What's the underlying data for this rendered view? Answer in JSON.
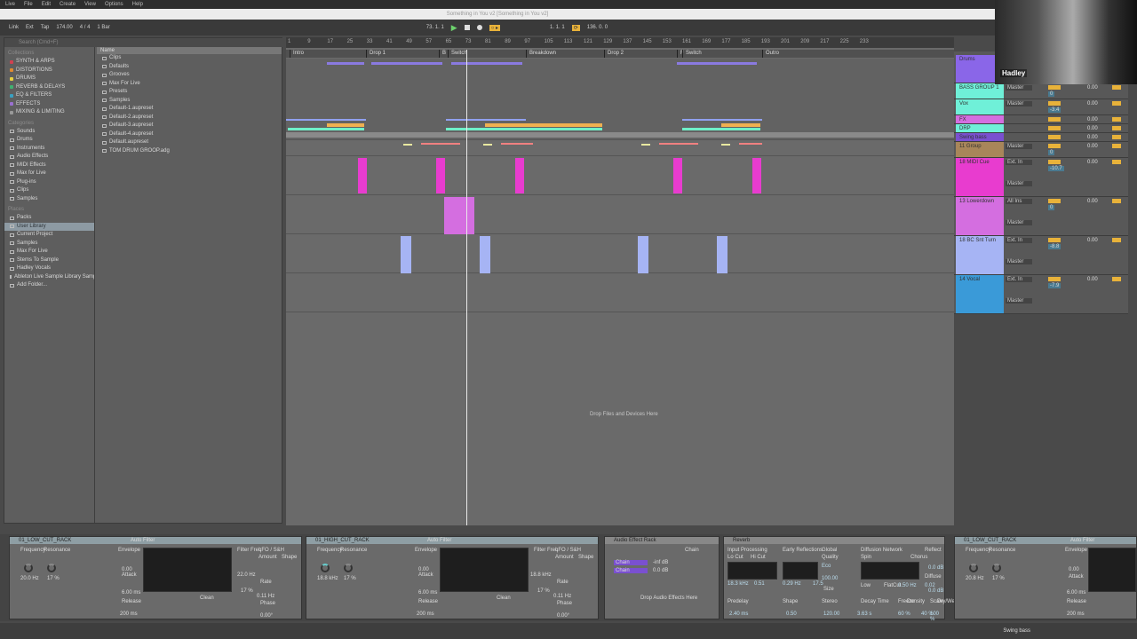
{
  "menubar": {
    "items": [
      "Live",
      "File",
      "Edit",
      "Create",
      "View",
      "Options",
      "Help"
    ]
  },
  "window": {
    "title": "Something in You v2  [Something in You v2]"
  },
  "transport": {
    "link": "Link",
    "ext": "Ext",
    "tap": "Tap",
    "tempo": "174.00",
    "time_signature": "4 / 4",
    "quantize": "1 Bar",
    "arrangement_position": "73. 1. 1",
    "loop_start": "1. 1. 1",
    "loop_length": "136. 0. 0"
  },
  "browser": {
    "search_placeholder": "Search (Cmd+F)",
    "collections_title": "Collections",
    "collections": [
      {
        "label": "SYNTH & ARPS",
        "color": "#d04050"
      },
      {
        "label": "DISTORTIONS",
        "color": "#e08a30"
      },
      {
        "label": "DRUMS",
        "color": "#e8d040"
      },
      {
        "label": "REVERB & DELAYS",
        "color": "#40b070"
      },
      {
        "label": "EQ & FILTERS",
        "color": "#3aa0c0"
      },
      {
        "label": "EFFECTS",
        "color": "#9a70d0"
      },
      {
        "label": "MIXING & LIMITING",
        "color": "#999999"
      }
    ],
    "categories_title": "Categories",
    "categories": [
      "Sounds",
      "Drums",
      "Instruments",
      "Audio Effects",
      "MIDI Effects",
      "Max for Live",
      "Plug-ins",
      "Clips",
      "Samples"
    ],
    "places_title": "Places",
    "places": [
      "Packs",
      "User Library",
      "Current Project",
      "Samples",
      "Max For Live",
      "Stems To Sample",
      "Hadley Vocals",
      "Ableton Live Sample Library Sample Pa",
      "Add Folder..."
    ],
    "selected_place": "User Library",
    "column_header": "Name",
    "files": [
      "Clips",
      "Defaults",
      "Grooves",
      "Max For Live",
      "Presets",
      "Samples",
      "Default-1.aupreset",
      "Default-2.aupreset",
      "Default-3.aupreset",
      "Default-4.aupreset",
      "Default.aupreset",
      "TOM DRUM GROOP.adg"
    ]
  },
  "arrangement": {
    "ruler_ticks": [
      "1",
      "9",
      "17",
      "25",
      "33",
      "41",
      "49",
      "57",
      "65",
      "73",
      "81",
      "89",
      "97",
      "105",
      "113",
      "121",
      "129",
      "137",
      "145",
      "153",
      "161",
      "169",
      "177",
      "185",
      "193",
      "201",
      "209",
      "217",
      "225",
      "233"
    ],
    "locators": [
      "Intro",
      "Drop 1",
      "B",
      "Switch",
      "Breakdown",
      "Drop 2",
      "F",
      "Switch",
      "Outro"
    ],
    "drop_message": "Drop Files and Devices Here",
    "colors": {
      "magenta": "#e83ccf",
      "violet": "#d46ee0",
      "periwinkle": "#a6b4f4",
      "teal": "#6ff0c8",
      "orange": "#f0b050",
      "salmon": "#f08080"
    }
  },
  "mixer": {
    "tracks": [
      {
        "name": "Drums",
        "color": "#8a66e8",
        "route": "",
        "volume": "",
        "pan": "0.00"
      },
      {
        "name": "BASS GROUP 1",
        "color": "#6ff0d8",
        "route": "Master",
        "volume": "0",
        "pan": "0.00"
      },
      {
        "name": "Vox",
        "color": "#6ff0d8",
        "route": "Master",
        "volume": "-3.4",
        "pan": "0.00"
      },
      {
        "name": "FX",
        "color": "#d46ee0",
        "route": "",
        "volume": "",
        "pan": "0.00"
      },
      {
        "name": "DRP",
        "color": "#6ff0d8",
        "route": "",
        "volume": "",
        "pan": "0.00"
      },
      {
        "name": "Swing bass",
        "color": "#7a50d0",
        "route": "",
        "volume": "",
        "pan": "0.00"
      },
      {
        "name": "11 Group",
        "color": "#a8865a",
        "route": "Master",
        "volume": "0",
        "pan": "0.00"
      },
      {
        "name": "18 MIDI Cue",
        "color": "#e83ccf",
        "route": "Ext. In",
        "volume": "-10.7",
        "pan": "0.00"
      },
      {
        "name": "13 Lowerdown",
        "color": "#d46ee0",
        "route": "All Ins",
        "volume": "0",
        "pan": "0.00"
      },
      {
        "name": "18 BC Snt Turn",
        "color": "#a6b4f4",
        "route": "Ext. In",
        "volume": "-8.8",
        "pan": "0.00"
      },
      {
        "name": "14 Vocal",
        "color": "#3a9ad8",
        "route": "Ext. In",
        "volume": "-7.9",
        "pan": "0.00"
      }
    ],
    "master_route": "Master"
  },
  "webcam": {
    "name": "Hadley"
  },
  "devices": [
    {
      "title": "01_LOW_CUT_RACK",
      "sub": "Auto Filter",
      "macros": [
        "Frequency",
        "Resonance"
      ],
      "values": [
        "20.0 Hz",
        "17 %"
      ],
      "labels": [
        "Envelope",
        "Attack",
        "Release",
        "Filter Freq",
        "LFO / S&H",
        "Amount",
        "Shape",
        "Rate",
        "Phase"
      ],
      "readouts": [
        "0.00",
        "6.00 ms",
        "200 ms",
        "22.0 Hz",
        "0.11 Hz",
        "0.00°",
        "17 %",
        "Clean"
      ]
    },
    {
      "title": "01_HIGH_CUT_RACK",
      "sub": "Auto Filter",
      "macros": [
        "Frequency",
        "Resonance"
      ],
      "values": [
        "18.8 kHz",
        "17 %"
      ],
      "labels": [
        "Envelope",
        "Attack",
        "Release",
        "Filter Freq",
        "LFO / S&H",
        "Amount",
        "Shape",
        "Rate",
        "Phase"
      ],
      "readouts": [
        "0.00",
        "6.00 ms",
        "200 ms",
        "18.8 kHz",
        "0.11 Hz",
        "0.00°",
        "17 %",
        "Clean"
      ]
    },
    {
      "title": "Audio Effect Rack",
      "chains": [
        "Chain",
        "Chain"
      ],
      "chain_label": "Chain",
      "chain_values": [
        "-inf dB",
        "0.0 dB"
      ],
      "drop": "Drop Audio Effects Here"
    },
    {
      "title": "Reverb",
      "labels": [
        "Input Processing",
        "Early Reflections",
        "Global",
        "Quality",
        "Diffusion Network",
        "Reflect",
        "Diffuse",
        "Predelay",
        "Shape",
        "Stereo",
        "Decay Time",
        "Freeze",
        "Density",
        "Scale",
        "Dry/Wet",
        "Size",
        "Lo Cut",
        "Hi Cut",
        "Spin",
        "Chorus",
        "Low",
        "Flat",
        "Cut"
      ],
      "readouts": [
        "18.3 kHz",
        "0.51",
        "0.29 Hz",
        "17.5",
        "Eco",
        "100.00",
        "2.40 ms",
        "0.50",
        "120.00",
        "3.63 s",
        "60 %",
        "40 %",
        "100 %",
        "0.0 dB",
        "0.0 dB",
        "0.50 Hz",
        "0.02"
      ]
    },
    {
      "title": "01_LOW_CUT_RACK",
      "sub": "Auto Filter",
      "macros": [
        "Frequency",
        "Resonance"
      ],
      "values": [
        "20.8 Hz",
        "17 %"
      ],
      "labels": [
        "Envelope",
        "Attack",
        "Release"
      ],
      "readouts": [
        "0.00",
        "6.00 ms",
        "200 ms"
      ]
    }
  ],
  "status": {
    "track": "Swing bass"
  }
}
